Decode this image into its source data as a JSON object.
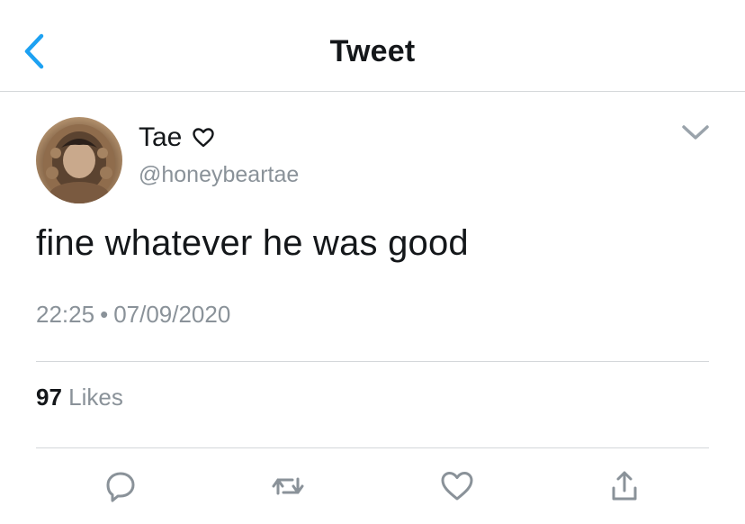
{
  "nav": {
    "title": "Tweet"
  },
  "user": {
    "display_name": "Tae",
    "handle": "@honeybeartae"
  },
  "tweet": {
    "text": "fine whatever he was good",
    "time": "22:25",
    "separator": "•",
    "date": "07/09/2020",
    "likes_count": "97",
    "likes_label": "Likes"
  },
  "actions": [
    "reply-icon",
    "retweet-icon",
    "like-icon",
    "share-icon"
  ],
  "colors": {
    "accent": "#1da1f2",
    "text": "#14171a",
    "secondary": "#8a9299",
    "divider": "#d4d7da"
  }
}
